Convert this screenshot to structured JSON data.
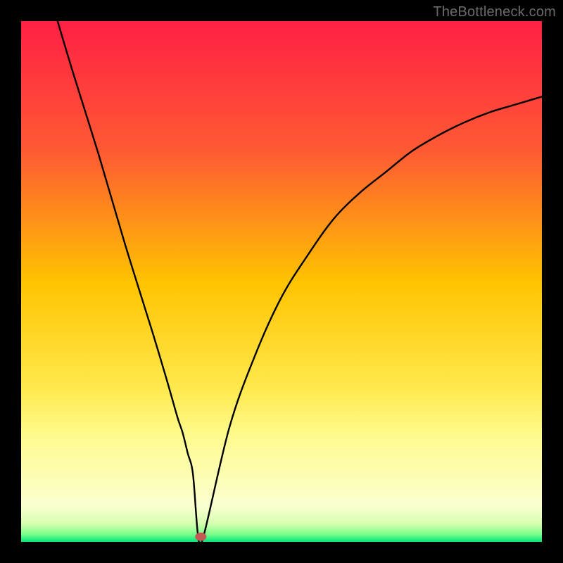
{
  "watermark": "TheBottleneck.com",
  "chart_data": {
    "type": "line",
    "title": "",
    "xlabel": "",
    "ylabel": "",
    "xlim": [
      0,
      100
    ],
    "ylim": [
      0,
      100
    ],
    "grid": false,
    "series": [
      {
        "name": "curve",
        "x": [
          7.0,
          10,
          15,
          20,
          25,
          28,
          30,
          31,
          32,
          33,
          34,
          35,
          40,
          45,
          50,
          55,
          60,
          65,
          70,
          75,
          80,
          85,
          90,
          95,
          100
        ],
        "values": [
          100,
          90,
          74,
          57,
          41,
          31,
          24,
          21,
          17,
          13,
          1,
          1,
          22,
          36,
          47,
          55,
          62,
          67,
          71,
          75,
          78,
          80.5,
          82.5,
          84,
          85.5
        ]
      }
    ],
    "marker": {
      "x": 34.5,
      "y": 1
    },
    "gradient_stops": [
      {
        "offset": 0,
        "color": "#ff2044"
      },
      {
        "offset": 0.25,
        "color": "#ff5a33"
      },
      {
        "offset": 0.5,
        "color": "#ffc300"
      },
      {
        "offset": 0.7,
        "color": "#ffe84a"
      },
      {
        "offset": 0.8,
        "color": "#fffb8f"
      },
      {
        "offset": 0.93,
        "color": "#fbffd0"
      },
      {
        "offset": 0.965,
        "color": "#d6ffb0"
      },
      {
        "offset": 0.985,
        "color": "#7cff8a"
      },
      {
        "offset": 1.0,
        "color": "#00e47a"
      }
    ]
  }
}
